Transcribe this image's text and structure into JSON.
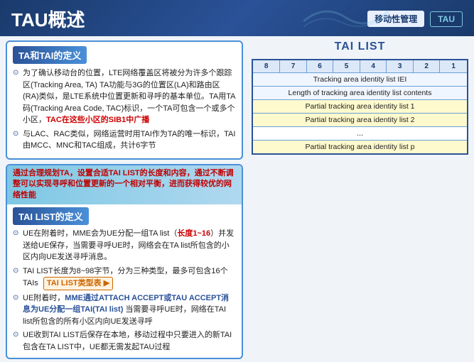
{
  "header": {
    "title": "TAU概述",
    "badge1": "移动性管理",
    "badge2": "TAU"
  },
  "ta_tai_section": {
    "title": "TA和TAI的定义",
    "items": [
      "为了确认移动台的位置，LTE网络覆盖区将被分为许多个跟踪区(Tracking Area, TA) TA功能与3G的位置区(LA)和路由区(RA)类似，是LTE系统中位置更新和寻呼的基本单位。TA用TA码(Tracking Area Code, TAC)标识，一个TA可包含一个或多个小区，TAC在这些小区的SIB1中广播",
      "与LAC、RAC类似，网络运营时用TAI作为TA的唯一标识，TAI由MCC、MNC和TAC组成，共计6字节"
    ],
    "highlight1": "TAC在这些小区的SIB1中广播",
    "highlight2": "TAI由MCC、MNC和TAC组成，共计6字节"
  },
  "tai_list_section": {
    "banner": "通过合理规划TA，设置合适TAI LIST的长度和内容，通过不断调整可以实现寻呼和位置更新的一个相对平衡，进而获得较优的网络性能",
    "title": "TAI LIST的定义",
    "items": [
      "UE在附着时，MME会为UE分配一组TA list（长度1~16）并发送给UE保存，当需要寻呼UE时，网络会在TA list所包含的小区内向UE发送寻呼消息。",
      "TAI LIST长度为8~98字节，分为三种类型，最多可包含16个TAIs",
      "UE附着时，MME通过ATTACH ACCEPT或TAU ACCEPT消息为UE分配一组TAI(TAI list) 当需要寻呼UE时，网络在TAI list所包含的所有小区内向UE发送寻呼",
      "UE收到TAI LIST后保存在本地，移动过程中只要进入的新TAI包含在TA LIST中，UE都无需发起TAU过程"
    ],
    "list_link": "TAI LIST类型表",
    "highlight1": "长度1~16",
    "highlight2": "MME通过ATTACH ACCEPT或TAU ACCEPT消息为UE分配一组TAI(TAI list)"
  },
  "tai_list_table": {
    "title": "TAI LIST",
    "columns": [
      "8",
      "7",
      "6",
      "5",
      "4",
      "3",
      "2",
      "1"
    ],
    "rows": [
      {
        "label": "Tracking area identity list IEI",
        "span": 8
      },
      {
        "label": "Length of tracking area identity list contents",
        "span": 8
      },
      {
        "label": "Partial tracking area identity list 1",
        "span": 8
      },
      {
        "label": "Partial tracking area identity list 2",
        "span": 8
      },
      {
        "label": "...",
        "span": 8,
        "dots": true
      },
      {
        "label": "Partial tracking area identity list p",
        "span": 8
      }
    ]
  }
}
